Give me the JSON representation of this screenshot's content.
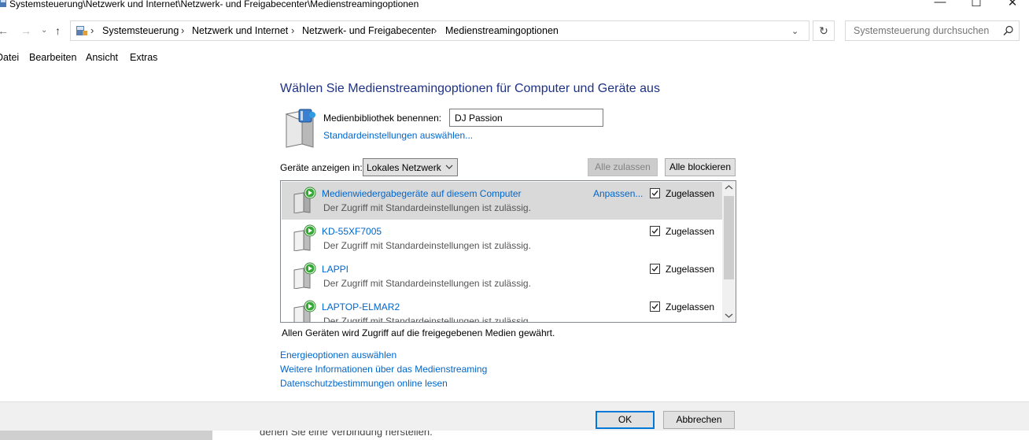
{
  "window": {
    "title": "Systemsteuerung\\Netzwerk und Internet\\Netzwerk- und Freigabecenter\\Medienstreamingoptionen",
    "minimize": "—",
    "maximize": "☐",
    "close": "✕"
  },
  "nav": {
    "back": "←",
    "forward": "→",
    "recent": "⌄",
    "up": "↑"
  },
  "breadcrumb": {
    "items": [
      "Systemsteuerung",
      "Netzwerk und Internet",
      "Netzwerk- und Freigabecenter",
      "Medienstreamingoptionen"
    ],
    "separator": "›",
    "dropdown": "⌄",
    "refresh": "↻"
  },
  "search": {
    "placeholder": "Systemsteuerung durchsuchen"
  },
  "menu": {
    "items": [
      "Datei",
      "Bearbeiten",
      "Ansicht",
      "Extras"
    ]
  },
  "main": {
    "heading": "Wählen Sie Medienstreamingoptionen für Computer und Geräte aus",
    "library_label": "Medienbibliothek benennen:",
    "library_name": "DJ Passion",
    "defaults_link": "Standardeinstellungen auswählen...",
    "show_devices_label": "Geräte anzeigen in:",
    "show_devices_value": "Lokales Netzwerk",
    "allow_all": "Alle zulassen",
    "block_all": "Alle blockieren",
    "devices": [
      {
        "name": "Medienwiedergabegeräte auf diesem Computer",
        "desc": "Der Zugriff mit Standardeinstellungen ist zulässig.",
        "customize": "Anpassen...",
        "status": "Zugelassen",
        "checked": true,
        "selected": true
      },
      {
        "name": "KD-55XF7005",
        "desc": "Der Zugriff mit Standardeinstellungen ist zulässig.",
        "customize": "",
        "status": "Zugelassen",
        "checked": true,
        "selected": false
      },
      {
        "name": "LAPPI",
        "desc": "Der Zugriff mit Standardeinstellungen ist zulässig.",
        "customize": "",
        "status": "Zugelassen",
        "checked": true,
        "selected": false
      },
      {
        "name": "LAPTOP-ELMAR2",
        "desc": "Der Zugriff mit Standardeinstellungen ist zulässig.",
        "customize": "",
        "status": "Zugelassen",
        "checked": true,
        "selected": false
      }
    ],
    "summary": "Allen Geräten wird Zugriff auf die freigegebenen Medien gewährt.",
    "links": [
      "Energieoptionen auswählen",
      "Weitere Informationen über das Medienstreaming",
      "Datenschutzbestimmungen online lesen"
    ]
  },
  "footer": {
    "ok": "OK",
    "cancel": "Abbrechen"
  },
  "behind_window": {
    "text": "denen Sie eine Verbindung herstellen."
  },
  "colors": {
    "heading": "#1e3287",
    "link": "#0066cc",
    "selected_row": "#d9d9d9",
    "default_button_border": "#0078d7"
  }
}
